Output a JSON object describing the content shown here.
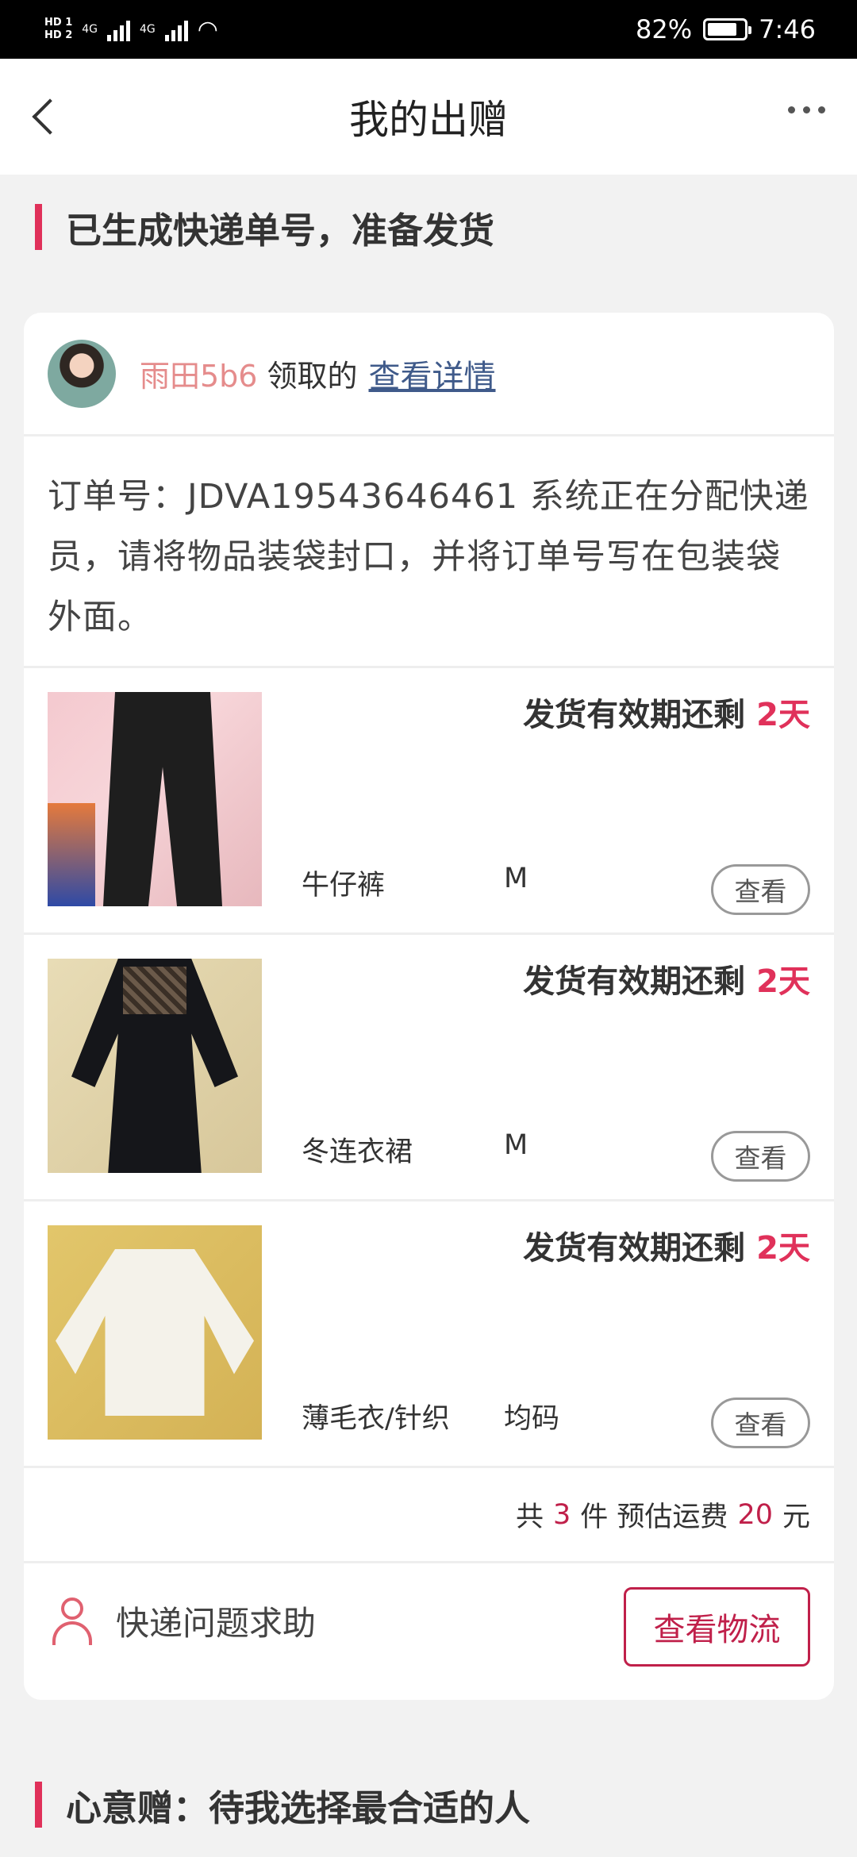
{
  "status_bar": {
    "hd1": "HD 1",
    "hd2": "HD 2",
    "net1": "4G",
    "net2": "4G",
    "battery_percent": "82%",
    "time": "7:46"
  },
  "nav": {
    "title": "我的出赠",
    "back_icon": "chevron-left-icon",
    "more_icon": "more-dots-icon"
  },
  "section1": {
    "title": "已生成快递单号，准备发货"
  },
  "order": {
    "recipient_name": "雨田5b6",
    "recipient_verb": "领取的",
    "detail_link": "查看详情",
    "notice": "订单号：JDVA19543646461 系统正在分配快递员，请将物品装袋封口，并将订单号写在包装袋外面。",
    "items": [
      {
        "deadline_label": "发货有效期还剩",
        "deadline_days": "2天",
        "name": "牛仔裤",
        "size": "M",
        "view_label": "查看"
      },
      {
        "deadline_label": "发货有效期还剩",
        "deadline_days": "2天",
        "name": "冬连衣裙",
        "size": "M",
        "view_label": "查看"
      },
      {
        "deadline_label": "发货有效期还剩",
        "deadline_days": "2天",
        "name": "薄毛衣/针织",
        "size": "均码",
        "view_label": "查看"
      }
    ],
    "summary": {
      "prefix": "共",
      "count": "3",
      "mid": "件 预估运费",
      "fee": "20",
      "suffix": "元"
    },
    "help_label": "快递问题求助",
    "logistics_button": "查看物流"
  },
  "section2": {
    "title": "心意赠：待我选择最合适的人"
  },
  "colors": {
    "accent": "#e0315a",
    "brand_red": "#c0204a",
    "recipient": "#e58c8c",
    "link": "#3f5a8a"
  }
}
